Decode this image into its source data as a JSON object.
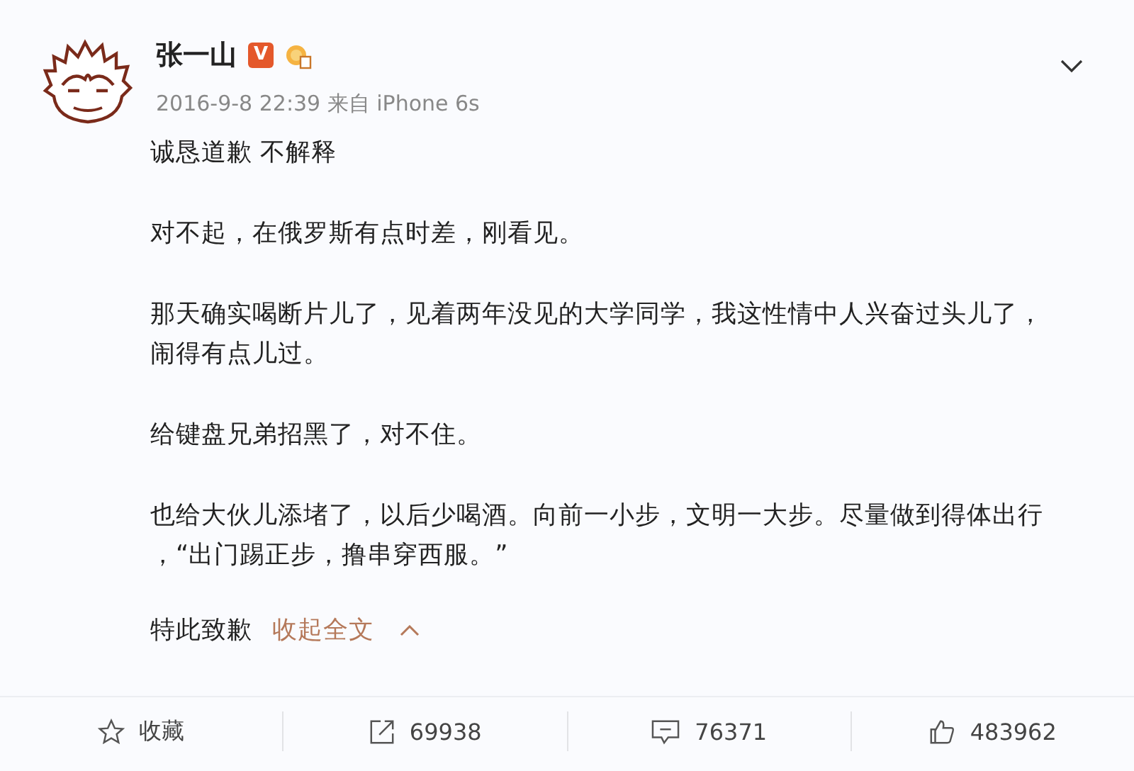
{
  "post": {
    "author": "张一山",
    "verified_badge": "V",
    "meta": "2016-9-8 22:39 来自 iPhone 6s",
    "paragraphs": [
      {
        "lines": [
          "诚恳道歉 不解释"
        ]
      },
      {
        "lines": [
          "对不起，在俄罗斯有点时差，刚看见。"
        ]
      },
      {
        "lines": [
          "那天确实喝断片儿了，见着两年没见的大学同学，我这性情中人兴奋过头儿了，",
          "闹得有点儿过。"
        ]
      },
      {
        "lines": [
          "给键盘兄弟招黑了，对不住。"
        ]
      },
      {
        "lines": [
          "也给大伙儿添堵了，以后少喝酒。向前一小步，文明一大步。尽量做到得体出行",
          "，“出门踢正步，撸串穿西服。”"
        ]
      }
    ],
    "closing": "特此致歉",
    "collapse_link": "收起全文"
  },
  "actions": [
    {
      "kind": "favorite",
      "label": "收藏"
    },
    {
      "kind": "repost",
      "label": "69938"
    },
    {
      "kind": "comment",
      "label": "76371"
    },
    {
      "kind": "like",
      "label": "483962"
    }
  ]
}
